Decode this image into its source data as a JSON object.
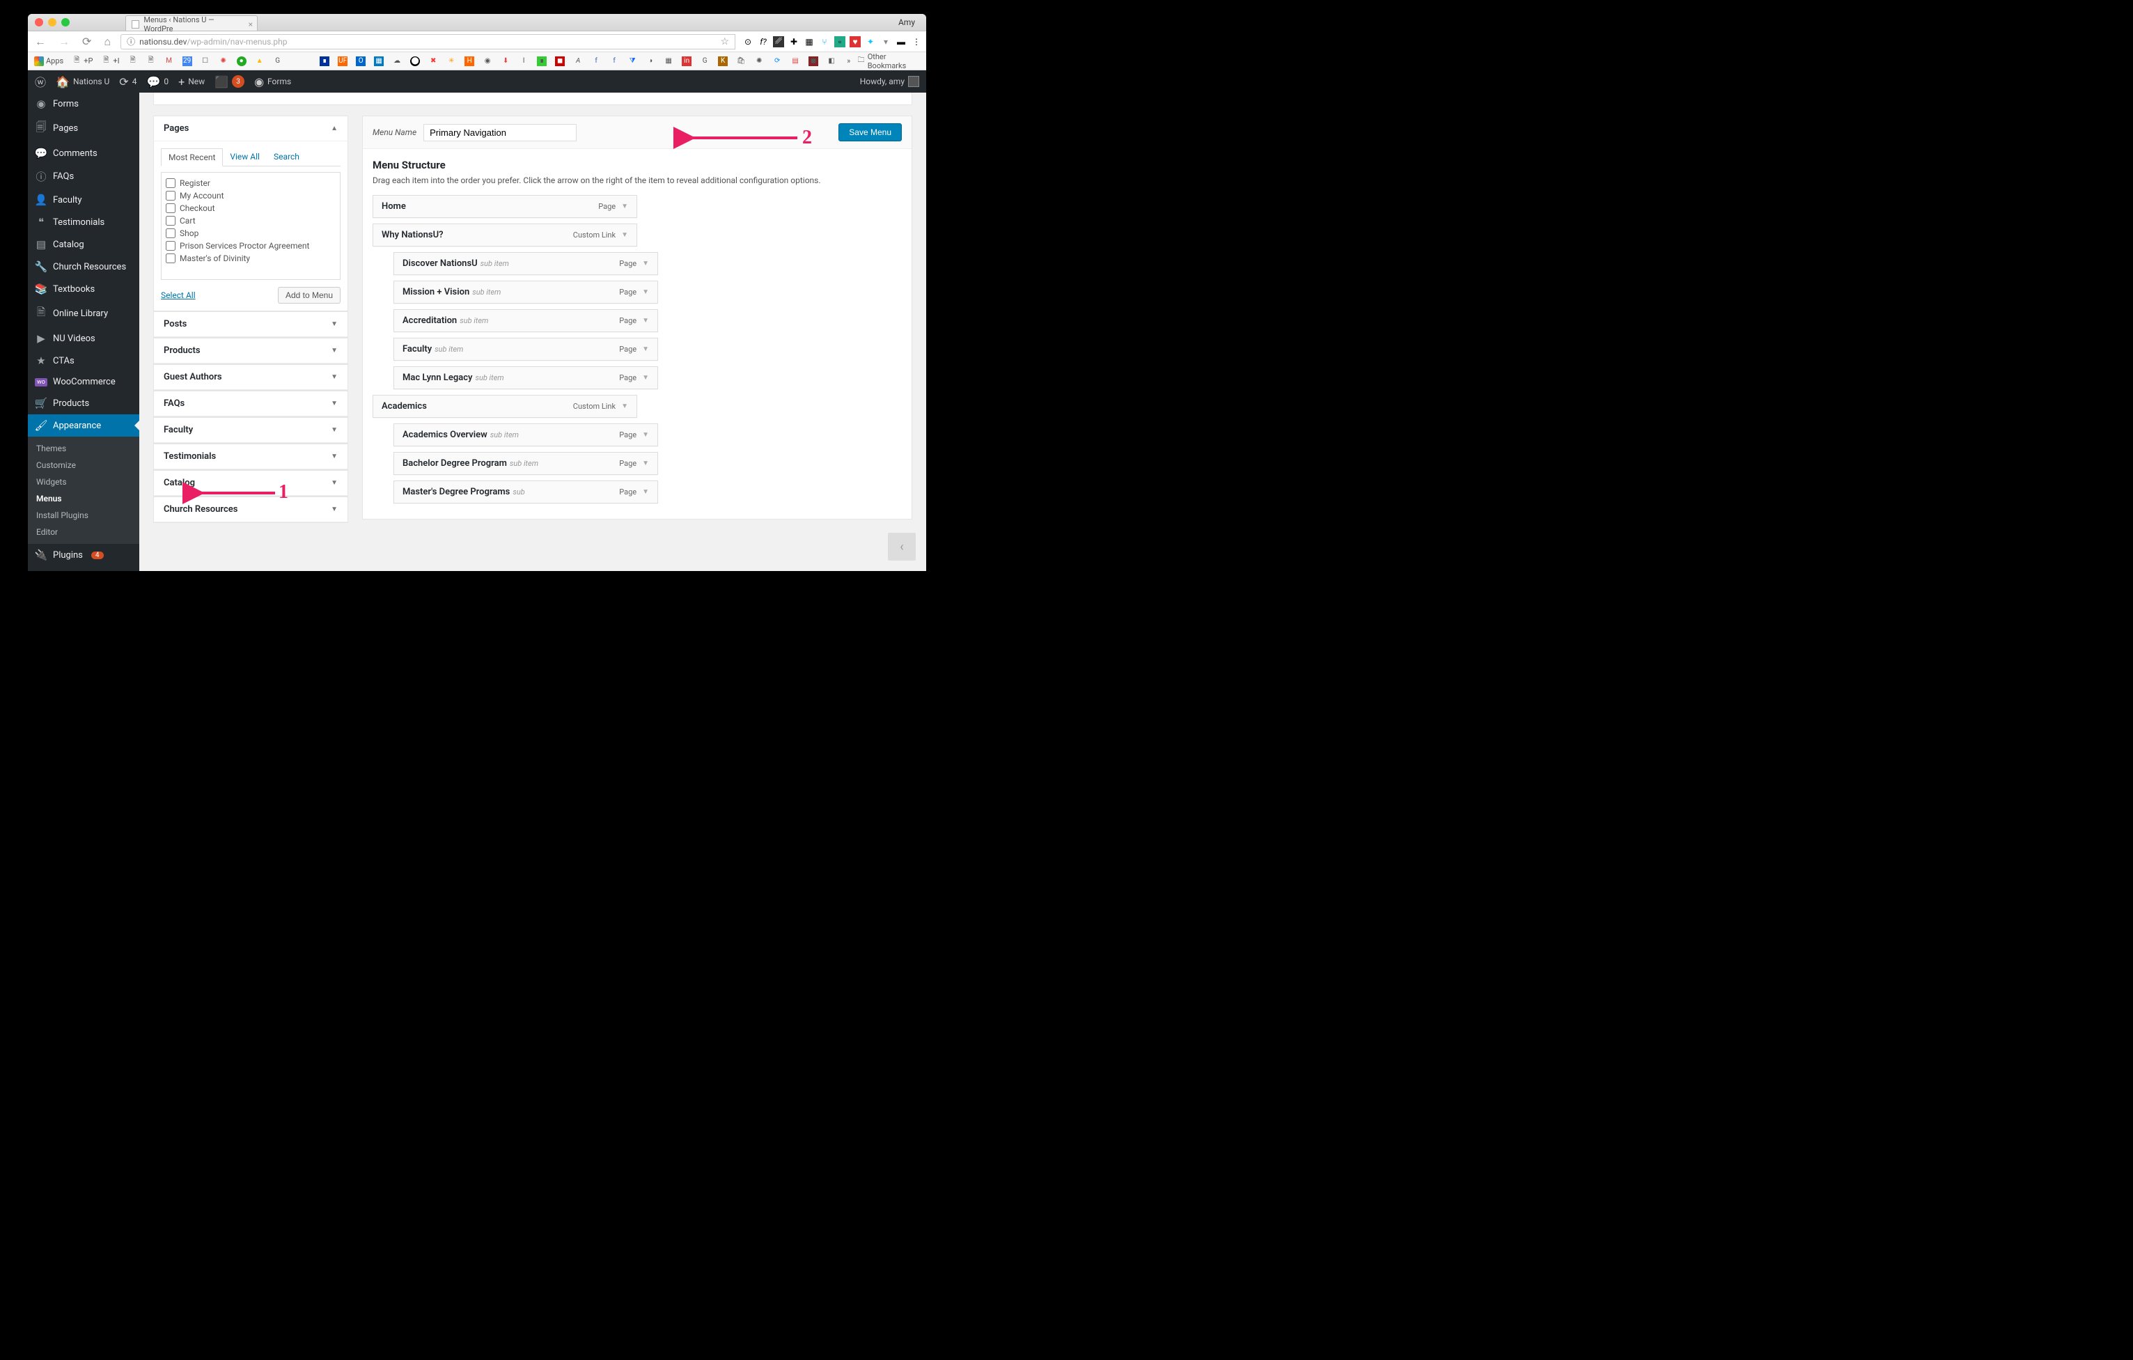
{
  "browser": {
    "user_label": "Amy",
    "tab_title": "Menus ‹ Nations U — WordPre",
    "url_host": "nationsu.dev",
    "url_path": "/wp-admin/nav-menus.php",
    "bookmarks_bar": {
      "apps": "Apps",
      "addP": "+P",
      "addI": "+I",
      "other": "Other Bookmarks"
    }
  },
  "adminbar": {
    "site": "Nations U",
    "updates": "4",
    "comments": "0",
    "new": "New",
    "seo_badge": "3",
    "forms": "Forms",
    "howdy": "Howdy, amy"
  },
  "sidebar": {
    "forms": "Forms",
    "pages": "Pages",
    "comments": "Comments",
    "faqs": "FAQs",
    "faculty": "Faculty",
    "testimonials": "Testimonials",
    "catalog": "Catalog",
    "church": "Church Resources",
    "textbooks": "Textbooks",
    "library": "Online Library",
    "videos": "NU Videos",
    "ctas": "CTAs",
    "woo": "WooCommerce",
    "products": "Products",
    "appearance": "Appearance",
    "sub": {
      "themes": "Themes",
      "customize": "Customize",
      "widgets": "Widgets",
      "menus": "Menus",
      "plugins": "Install Plugins",
      "editor": "Editor"
    },
    "pluginsItem": "Plugins",
    "plugins_count": "4"
  },
  "accordion": {
    "pages": {
      "title": "Pages",
      "tab_recent": "Most Recent",
      "tab_viewall": "View All",
      "tab_search": "Search",
      "items": [
        "Register",
        "My Account",
        "Checkout",
        "Cart",
        "Shop",
        "Prison Services Proctor Agreement",
        "Master's of Divinity"
      ],
      "select_all": "Select All",
      "add_btn": "Add to Menu"
    },
    "posts": "Posts",
    "products": "Products",
    "guest": "Guest Authors",
    "faqs": "FAQs",
    "faculty": "Faculty",
    "testimonials": "Testimonials",
    "catalog": "Catalog",
    "church": "Church Resources"
  },
  "menu_panel": {
    "name_label": "Menu Name",
    "name_value": "Primary Navigation",
    "save": "Save Menu",
    "structure_heading": "Menu Structure",
    "structure_desc": "Drag each item into the order you prefer. Click the arrow on the right of the item to reveal additional configuration options.",
    "sub_label": "sub item",
    "sub_short": "sub",
    "items": [
      {
        "title": "Home",
        "type": "Page",
        "sub": false
      },
      {
        "title": "Why NationsU?",
        "type": "Custom Link",
        "sub": false
      },
      {
        "title": "Discover NationsU",
        "type": "Page",
        "sub": true
      },
      {
        "title": "Mission + Vision",
        "type": "Page",
        "sub": true
      },
      {
        "title": "Accreditation",
        "type": "Page",
        "sub": true
      },
      {
        "title": "Faculty",
        "type": "Page",
        "sub": true
      },
      {
        "title": "Mac Lynn Legacy",
        "type": "Page",
        "sub": true
      },
      {
        "title": "Academics",
        "type": "Custom Link",
        "sub": false
      },
      {
        "title": "Academics Overview",
        "type": "Page",
        "sub": true
      },
      {
        "title": "Bachelor Degree Program",
        "type": "Page",
        "sub": true,
        "sublabel": "sub item"
      },
      {
        "title": "Master's Degree Programs",
        "type": "Page",
        "sub": true,
        "sublabel": "sub"
      }
    ]
  },
  "annotations": {
    "one": "1",
    "two": "2"
  }
}
